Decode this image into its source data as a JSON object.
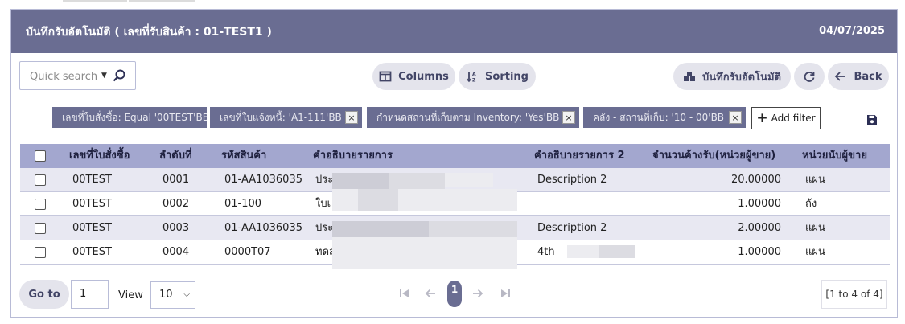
{
  "header": {
    "title": "บันทึกรับอัตโนมัติ ( เลขที่รับสินค้า : 01-TEST1 )",
    "date": "04/07/2025"
  },
  "toolbar": {
    "search_placeholder": "Quick search",
    "columns_label": "Columns",
    "sorting_label": "Sorting",
    "auto_receive_label": "บันทึกรับอัตโนมัติ",
    "back_label": "Back"
  },
  "filters": {
    "chips": [
      "เลขที่ใบสั่งซื้อ: Equal '00TEST'BB",
      "เลขที่ใบแจ้งหนี้: 'A1-111'BB",
      "กำหนดสถานที่เก็บตาม Inventory: 'Yes'BB",
      "คลัง - สถานที่เก็บ: '10 - 00'BB"
    ],
    "add_filter_label": "Add filter"
  },
  "table": {
    "columns": [
      "เลขที่ใบสั่งซื้อ",
      "ลำดับที่",
      "รหัสสินค้า",
      "คำอธิบายรายการ",
      "คำอธิบายรายการ 2",
      "จำนวนค้างรับ(หน่วยผู้ขาย)",
      "หน่วยนับผู้ขาย"
    ],
    "rows": [
      {
        "po": "00TEST",
        "seq": "0001",
        "code": "01-AA1036035",
        "desc": "ประ",
        "desc2": "Description 2",
        "qty": "20.00000",
        "unit": "แผ่น"
      },
      {
        "po": "00TEST",
        "seq": "0002",
        "code": "01-100",
        "desc": "ใบเ",
        "desc2": "",
        "qty": "1.00000",
        "unit": "ถัง"
      },
      {
        "po": "00TEST",
        "seq": "0003",
        "code": "01-AA1036035",
        "desc": "ประ",
        "desc2": "Description 2",
        "qty": "2.00000",
        "unit": "แผ่น"
      },
      {
        "po": "00TEST",
        "seq": "0004",
        "code": "0000T07",
        "desc": "ทดส",
        "desc2": "4th",
        "qty": "1.00000",
        "unit": "แผ่น"
      }
    ]
  },
  "footer": {
    "goto_label": "Go to",
    "page_value": "1",
    "view_label": "View",
    "view_value": "10",
    "current_page": "1",
    "range_text": "[1 to 4 of 4]"
  },
  "colors": {
    "header_bg": "#6a6d92",
    "table_header_bg": "#a3a7cf",
    "pill_bg": "#e4e4ec"
  }
}
